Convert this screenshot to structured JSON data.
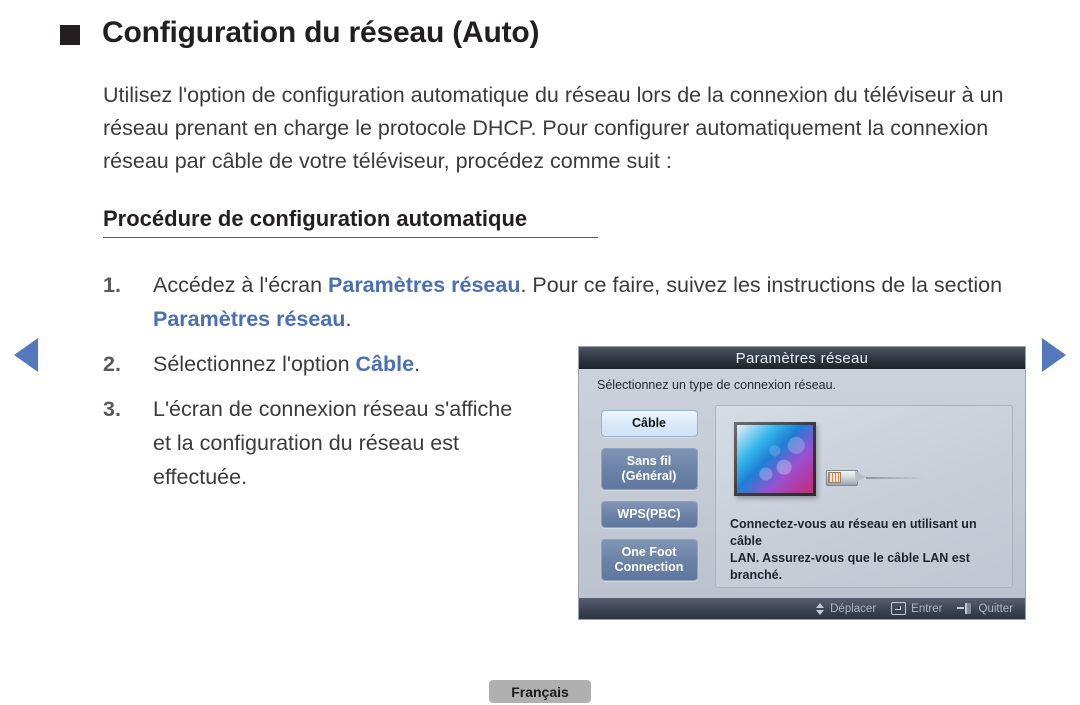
{
  "page": {
    "title": "Configuration du réseau (Auto)",
    "bullet_icon": "filled-square-icon",
    "intro": "Utilisez l'option de configuration automatique du réseau lors de la connexion du téléviseur à un réseau prenant en charge le protocole DHCP. Pour configurer automatiquement la connexion réseau par câble de votre téléviseur, procédez comme suit :",
    "subheading": "Procédure de configuration automatique",
    "language_badge": "Français",
    "accent_blue": "#4a6fb5",
    "nav_arrow_color": "#5578ba"
  },
  "nav": {
    "prev_icon": "triangle-left-icon",
    "next_icon": "triangle-right-icon"
  },
  "steps": [
    {
      "number": "1.",
      "part1": "Accédez à l'écran ",
      "hl1": "Paramètres réseau",
      "part2": ". Pour ce faire, suivez les instructions de la section ",
      "hl2": "Paramètres réseau",
      "part3": "."
    },
    {
      "number": "2.",
      "part1": "Sélectionnez l'option ",
      "hl1": "Câble",
      "part2": "."
    },
    {
      "number": "3.",
      "part1": "L'écran de connexion réseau s'affiche et la configuration du réseau est effectuée.",
      "hl1": "",
      "part2": ""
    }
  ],
  "osd": {
    "title": "Paramètres réseau",
    "subtitle": "Sélectionnez un type de connexion réseau.",
    "menu": [
      {
        "label": "Câble",
        "selected": true
      },
      {
        "label": "Sans fil\n(Général)",
        "line1": "Sans fil",
        "line2": "(Général)",
        "selected": false
      },
      {
        "label": "WPS(PBC)",
        "selected": false
      },
      {
        "label": "One Foot\nConnection",
        "line1": "One Foot",
        "line2": "Connection",
        "selected": false
      }
    ],
    "detail": {
      "illustration": "tv-with-lan-cable",
      "text_line1": "Connectez-vous au réseau en utilisant un câble",
      "text_line2": "LAN. Assurez-vous que le câble LAN est branché."
    },
    "footer": [
      {
        "icon": "up-down-arrow-icon",
        "label": "Déplacer"
      },
      {
        "icon": "enter-key-icon",
        "label": "Entrer"
      },
      {
        "icon": "exit-key-icon",
        "label": "Quitter"
      }
    ]
  }
}
